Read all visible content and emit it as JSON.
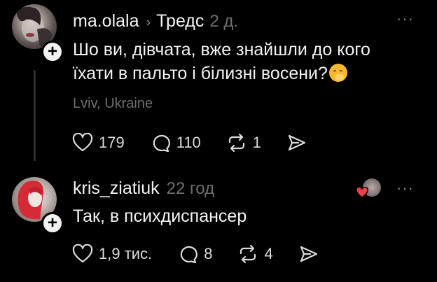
{
  "posts": [
    {
      "username": "ma.olala",
      "topic": "Тредс",
      "time": "2 д.",
      "text_line1": "Шо ви, дівчата, вже знайшли до кого",
      "text_line2": "їхати в пальто і білизні восени?",
      "emoji": "shushing-face-emoji",
      "location": "Lviv, Ukraine",
      "likes": "179",
      "replies": "110",
      "reposts": "1",
      "more": "···"
    },
    {
      "username": "kris_ziatiuk",
      "time": "22 год",
      "text": "Так, в психдиспансер",
      "likes": "1,9 тис.",
      "replies": "8",
      "reposts": "4",
      "more": "···"
    }
  ],
  "icons": {
    "like": "heart-icon",
    "reply": "comment-bubble-icon",
    "repost": "repost-arrows-icon",
    "share": "send-arrow-icon",
    "follow": "plus-icon"
  },
  "colors": {
    "background": "#000000",
    "text": "#f3f3f3",
    "muted": "#6f6f6f",
    "heart_badge": "#e8414a"
  }
}
